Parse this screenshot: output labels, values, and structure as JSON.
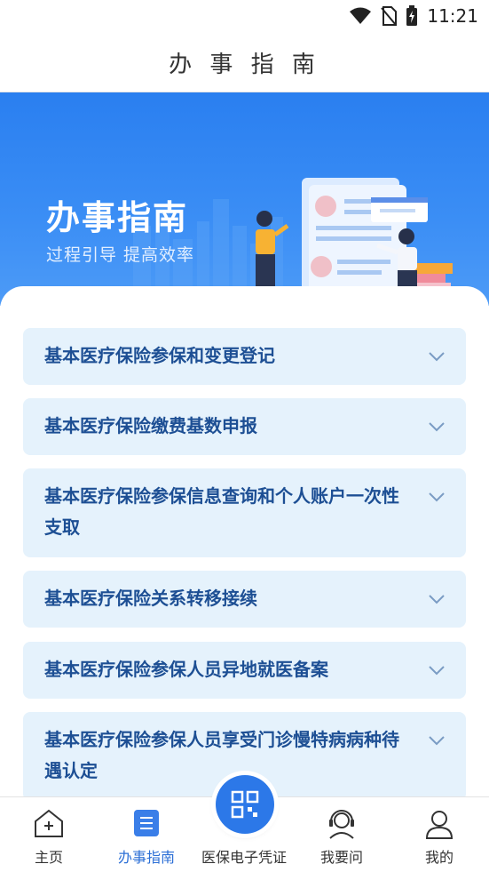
{
  "status_bar": {
    "time": "11:21"
  },
  "header": {
    "title": "办 事 指 南"
  },
  "banner": {
    "title": "办事指南",
    "subtitle": "过程引导  提高效率"
  },
  "guide_items": [
    {
      "line1": "基本医疗保险参保和变更登记",
      "line2": ""
    },
    {
      "line1": "基本医疗保险缴费基数申报",
      "line2": ""
    },
    {
      "line1": "基本医疗保险参保信息查询和个人账户一次性",
      "line2": "支取"
    },
    {
      "line1": "基本医疗保险关系转移接续",
      "line2": ""
    },
    {
      "line1": "基本医疗保险参保人员异地就医备案",
      "line2": ""
    },
    {
      "line1": "基本医疗保险参保人员享受门诊慢特病病种待",
      "line2": "遇认定"
    }
  ],
  "tab_bar": {
    "home": "主页",
    "guide": "办事指南",
    "voucher": "医保电子凭证",
    "ask": "我要问",
    "mine": "我的"
  },
  "colors": {
    "accent": "#2c6fd6",
    "item_bg": "#e5f2fc",
    "item_text": "#1d4f94",
    "banner": "#3b8ef5"
  }
}
